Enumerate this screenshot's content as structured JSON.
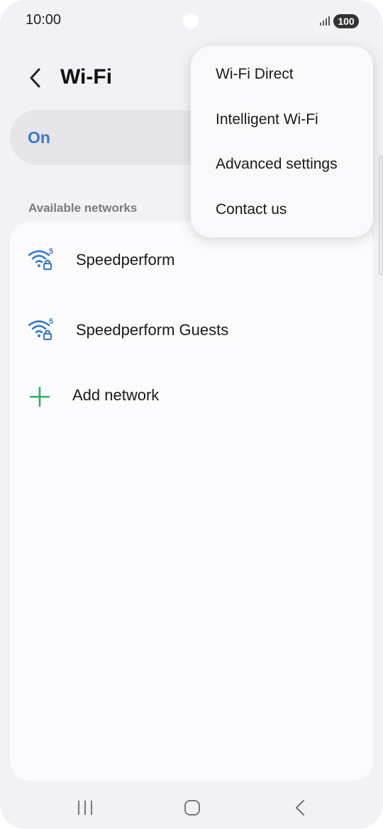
{
  "status_bar": {
    "time": "10:00",
    "battery": "100"
  },
  "header": {
    "title": "Wi-Fi"
  },
  "wifi_toggle": {
    "label": "On",
    "state": "on"
  },
  "available_networks": {
    "section_label": "Available networks",
    "networks": [
      {
        "name": "Speedperform",
        "band": "5"
      },
      {
        "name": "Speedperform Guests",
        "band": "5"
      }
    ],
    "add_label": "Add network"
  },
  "menu": {
    "items": [
      {
        "label": "Wi-Fi Direct"
      },
      {
        "label": "Intelligent Wi-Fi"
      },
      {
        "label": "Advanced settings"
      },
      {
        "label": "Contact us"
      }
    ]
  },
  "icons": {
    "back": "chevron-left-icon",
    "wifi": "wifi-locked-icon",
    "add": "plus-icon",
    "recents": "recents-icon",
    "home": "home-icon",
    "nav_back": "back-icon"
  },
  "colors": {
    "accent": "#3e78c9",
    "add_green": "#2fae62",
    "background": "#f2f2f6"
  }
}
